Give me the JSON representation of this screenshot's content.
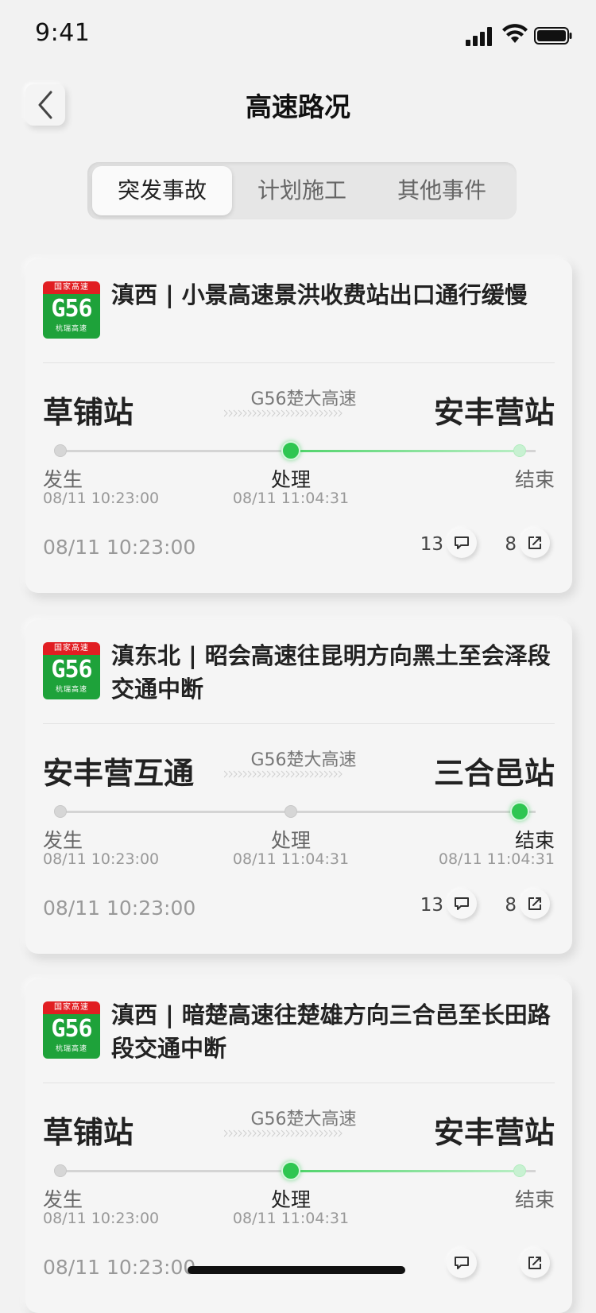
{
  "status": {
    "time": "9:41"
  },
  "header": {
    "title": "高速路况"
  },
  "tabs": [
    {
      "label": "突发事故",
      "active": true
    },
    {
      "label": "计划施工",
      "active": false
    },
    {
      "label": "其他事件",
      "active": false
    }
  ],
  "cards": [
    {
      "badge": {
        "top": "国家高速",
        "code": "G56",
        "sub": "杭瑞高速"
      },
      "title": "滇西 | 小景高速景洪收费站出口通行缓慢",
      "from": "草铺站",
      "to": "安丰营站",
      "road": "G56楚大高速",
      "current_stage": 1,
      "stages": [
        {
          "label": "发生",
          "time": "08/11 10:23:00"
        },
        {
          "label": "处理",
          "time": "08/11 11:04:31"
        },
        {
          "label": "结束",
          "time": ""
        }
      ],
      "footer_time": "08/11 10:23:00",
      "comments": "13",
      "shares": "8"
    },
    {
      "badge": {
        "top": "国家高速",
        "code": "G56",
        "sub": "杭瑞高速"
      },
      "title": "滇东北 | 昭会高速往昆明方向黑土至会泽段交通中断",
      "from": "安丰营互通",
      "to": "三合邑站",
      "road": "G56楚大高速",
      "current_stage": 2,
      "stages": [
        {
          "label": "发生",
          "time": "08/11 10:23:00"
        },
        {
          "label": "处理",
          "time": "08/11 11:04:31"
        },
        {
          "label": "结束",
          "time": "08/11 11:04:31"
        }
      ],
      "footer_time": "08/11 10:23:00",
      "comments": "13",
      "shares": "8"
    },
    {
      "badge": {
        "top": "国家高速",
        "code": "G56",
        "sub": "杭瑞高速"
      },
      "title": "滇西 | 暗楚高速往楚雄方向三合邑至长田路段交通中断",
      "from": "草铺站",
      "to": "安丰营站",
      "road": "G56楚大高速",
      "current_stage": 1,
      "stages": [
        {
          "label": "发生",
          "time": "08/11 10:23:00"
        },
        {
          "label": "处理",
          "time": "08/11 11:04:31"
        },
        {
          "label": "结束",
          "time": ""
        }
      ],
      "footer_time": "08/11 10:23:00",
      "comments": "",
      "shares": ""
    }
  ],
  "colors": {
    "accent_green": "#2ec651",
    "badge_red": "#e11e22",
    "badge_green": "#1ea23a"
  }
}
